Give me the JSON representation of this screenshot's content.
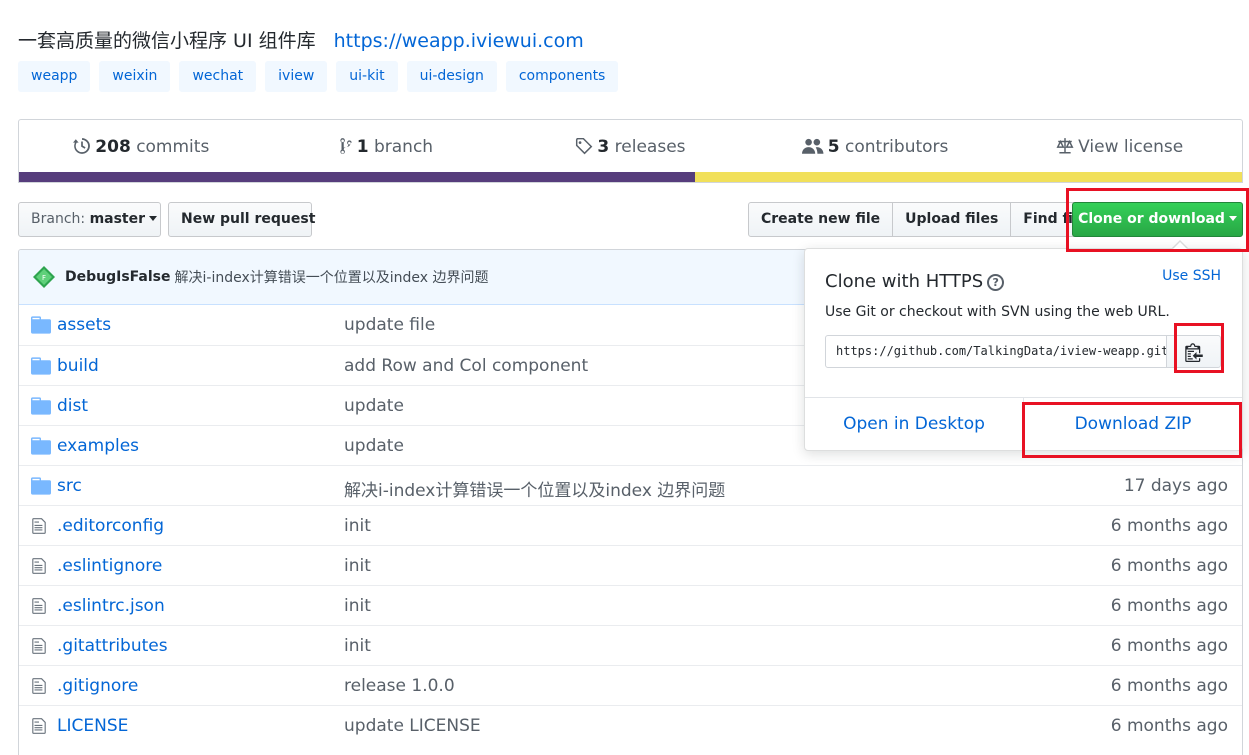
{
  "repo": {
    "description": "一套高质量的微信小程序 UI 组件库",
    "url": "https://weapp.iviewui.com",
    "topics": [
      "weapp",
      "weixin",
      "wechat",
      "iview",
      "ui-kit",
      "ui-design",
      "components"
    ]
  },
  "summary": {
    "commits_count": "208",
    "commits_label": "commits",
    "branches_count": "1",
    "branches_label": "branch",
    "releases_count": "3",
    "releases_label": "releases",
    "contributors_count": "5",
    "contributors_label": "contributors",
    "license_label": "View license"
  },
  "toolbar": {
    "branch_prefix": "Branch:",
    "branch_name": "master",
    "new_pr": "New pull request",
    "create_file": "Create new file",
    "upload_files": "Upload files",
    "find_file": "Find file",
    "clone": "Clone or download"
  },
  "latest_commit": {
    "author": "DebugIsFalse",
    "message": "解决i-index计算错误一个位置以及index 边界问题"
  },
  "files": [
    {
      "name": "assets",
      "type": "dir",
      "message": "update file",
      "age": ""
    },
    {
      "name": "build",
      "type": "dir",
      "message": "add Row and Col component",
      "age": ""
    },
    {
      "name": "dist",
      "type": "dir",
      "message": "update",
      "age": ""
    },
    {
      "name": "examples",
      "type": "dir",
      "message": "update",
      "age": ""
    },
    {
      "name": "src",
      "type": "dir",
      "message": "解决i-index计算错误一个位置以及index 边界问题",
      "age": "17 days ago"
    },
    {
      "name": ".editorconfig",
      "type": "file",
      "message": "init",
      "age": "6 months ago"
    },
    {
      "name": ".eslintignore",
      "type": "file",
      "message": "init",
      "age": "6 months ago"
    },
    {
      "name": ".eslintrc.json",
      "type": "file",
      "message": "init",
      "age": "6 months ago"
    },
    {
      "name": ".gitattributes",
      "type": "file",
      "message": "init",
      "age": "6 months ago"
    },
    {
      "name": ".gitignore",
      "type": "file",
      "message": "release 1.0.0",
      "age": "6 months ago"
    },
    {
      "name": "LICENSE",
      "type": "file",
      "message": "update LICENSE",
      "age": "6 months ago"
    }
  ],
  "clone_popover": {
    "title": "Clone with HTTPS",
    "use_ssh": "Use SSH",
    "description": "Use Git or checkout with SVN using the web URL.",
    "url_value": "https://github.com/TalkingData/iview-weapp.git",
    "open_desktop": "Open in Desktop",
    "download_zip": "Download ZIP"
  },
  "colors": {
    "accent_link": "#0366d6",
    "clone_button": "#28a745",
    "highlight": "#e81123",
    "lang_primary": "#563d7c",
    "lang_secondary": "#f1e05a"
  }
}
